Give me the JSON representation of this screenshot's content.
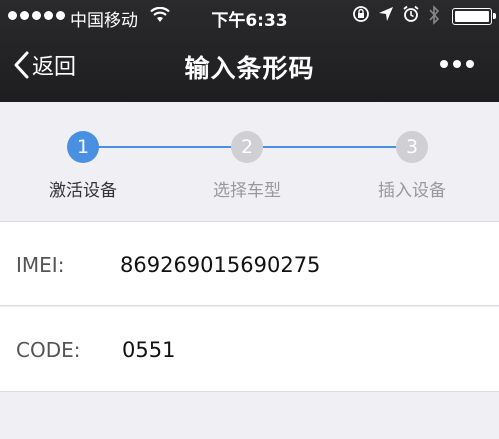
{
  "status_bar": {
    "carrier": "中国移动",
    "time": "下午6:33",
    "icons": [
      "rotation-lock-icon",
      "location-arrow-icon",
      "alarm-icon",
      "bluetooth-icon",
      "battery-icon"
    ]
  },
  "nav": {
    "back_label": "返回",
    "title": "输入条形码"
  },
  "colors": {
    "active": "#4a90e2",
    "inactive": "#cfcfd4",
    "bar": "#232325"
  },
  "steps": [
    {
      "number": "1",
      "label": "激活设备",
      "active": true
    },
    {
      "number": "2",
      "label": "选择车型",
      "active": false
    },
    {
      "number": "3",
      "label": "插入设备",
      "active": false
    }
  ],
  "form": {
    "imei_label": "IMEI:",
    "imei_value": "869269015690275",
    "code_label": "CODE:",
    "code_value": "0551"
  }
}
